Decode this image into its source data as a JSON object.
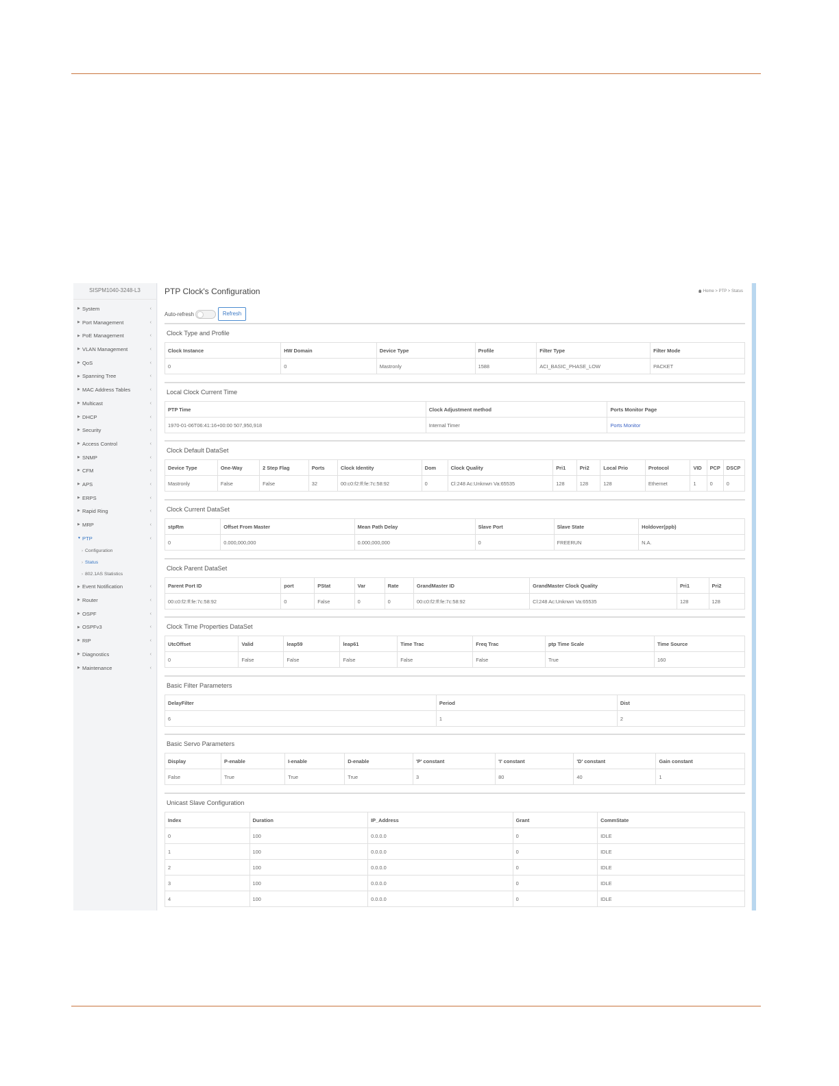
{
  "device_name": "SISPM1040-3248-L3",
  "sidebar": [
    {
      "label": "System"
    },
    {
      "label": "Port Management"
    },
    {
      "label": "PoE Management"
    },
    {
      "label": "VLAN Management"
    },
    {
      "label": "QoS"
    },
    {
      "label": "Spanning Tree"
    },
    {
      "label": "MAC Address Tables"
    },
    {
      "label": "Multicast"
    },
    {
      "label": "DHCP"
    },
    {
      "label": "Security"
    },
    {
      "label": "Access Control"
    },
    {
      "label": "SNMP"
    },
    {
      "label": "CFM"
    },
    {
      "label": "APS"
    },
    {
      "label": "ERPS"
    },
    {
      "label": "Rapid Ring"
    },
    {
      "label": "MRP"
    },
    {
      "label": "PTP"
    },
    {
      "label": "Event Notification"
    },
    {
      "label": "Router"
    },
    {
      "label": "OSPF"
    },
    {
      "label": "OSPFv3"
    },
    {
      "label": "RIP"
    },
    {
      "label": "Diagnostics"
    },
    {
      "label": "Maintenance"
    }
  ],
  "ptp_subitems": [
    "Configuration",
    "Status",
    "802.1AS Statistics"
  ],
  "page_title": "PTP Clock's Configuration",
  "breadcrumb": {
    "home": "Home",
    "sep": ">",
    "section": "PTP",
    "current": "Status"
  },
  "auto_refresh_label": "Auto-refresh",
  "refresh_label": "Refresh",
  "sections": {
    "clock_type": {
      "title": "Clock Type and Profile",
      "headers": [
        "Clock Instance",
        "HW Domain",
        "Device Type",
        "Profile",
        "Filter Type",
        "Filter Mode"
      ],
      "rows": [
        [
          "0",
          "0",
          "Mastronly",
          "1588",
          "ACI_BASIC_PHASE_LOW",
          "PACKET"
        ]
      ]
    },
    "local_clock": {
      "title": "Local Clock Current Time",
      "headers": [
        "PTP Time",
        "Clock Adjustment method",
        "Ports Monitor Page"
      ],
      "rows": [
        [
          "1970-01-06T06:41:16+00:00 507,950,918",
          "Internal Timer",
          "Ports Monitor"
        ]
      ]
    },
    "default_ds": {
      "title": "Clock Default DataSet",
      "headers": [
        "Device Type",
        "One-Way",
        "2 Step Flag",
        "Ports",
        "Clock Identity",
        "Dom",
        "Clock Quality",
        "Pri1",
        "Pri2",
        "Local Prio",
        "Protocol",
        "VID",
        "PCP",
        "DSCP"
      ],
      "rows": [
        [
          "Mastronly",
          "False",
          "False",
          "32",
          "00:c0:f2:ff:fe:7c:58:92",
          "0",
          "Cl:248 Ac:Unknwn Va:65535",
          "128",
          "128",
          "128",
          "Ethernet",
          "1",
          "0",
          "0"
        ]
      ]
    },
    "current_ds": {
      "title": "Clock Current DataSet",
      "headers": [
        "stpRm",
        "Offset From Master",
        "Mean Path Delay",
        "Slave Port",
        "Slave State",
        "Holdover(ppb)"
      ],
      "rows": [
        [
          "0",
          "0.000,000,000",
          "0.000,000,000",
          "0",
          "FREERUN",
          "N.A."
        ]
      ]
    },
    "parent_ds": {
      "title": "Clock Parent DataSet",
      "headers": [
        "Parent Port ID",
        "port",
        "PStat",
        "Var",
        "Rate",
        "GrandMaster ID",
        "GrandMaster Clock Quality",
        "Pri1",
        "Pri2"
      ],
      "rows": [
        [
          "00:c0:f2:ff:fe:7c:58:92",
          "0",
          "False",
          "0",
          "0",
          "00:c0:f2:ff:fe:7c:58:92",
          "Cl:248 Ac:Unknwn Va:65535",
          "128",
          "128"
        ]
      ]
    },
    "time_props": {
      "title": "Clock Time Properties DataSet",
      "headers": [
        "UtcOffset",
        "Valid",
        "leap59",
        "leap61",
        "Time Trac",
        "Freq Trac",
        "ptp Time Scale",
        "Time Source"
      ],
      "rows": [
        [
          "0",
          "False",
          "False",
          "False",
          "False",
          "False",
          "True",
          "160"
        ]
      ]
    },
    "filter_params": {
      "title": "Basic Filter Parameters",
      "headers": [
        "DelayFilter",
        "Period",
        "Dist"
      ],
      "rows": [
        [
          "6",
          "1",
          "2"
        ]
      ]
    },
    "servo_params": {
      "title": "Basic Servo Parameters",
      "headers": [
        "Display",
        "P-enable",
        "I-enable",
        "D-enable",
        "'P' constant",
        "'I' constant",
        "'D' constant",
        "Gain constant"
      ],
      "rows": [
        [
          "False",
          "True",
          "True",
          "True",
          "3",
          "80",
          "40",
          "1"
        ]
      ]
    },
    "unicast_slave": {
      "title": "Unicast Slave Configuration",
      "headers": [
        "Index",
        "Duration",
        "IP_Address",
        "Grant",
        "CommState"
      ],
      "rows": [
        [
          "0",
          "100",
          "0.0.0.0",
          "0",
          "IDLE"
        ],
        [
          "1",
          "100",
          "0.0.0.0",
          "0",
          "IDLE"
        ],
        [
          "2",
          "100",
          "0.0.0.0",
          "0",
          "IDLE"
        ],
        [
          "3",
          "100",
          "0.0.0.0",
          "0",
          "IDLE"
        ],
        [
          "4",
          "100",
          "0.0.0.0",
          "0",
          "IDLE"
        ]
      ]
    }
  }
}
